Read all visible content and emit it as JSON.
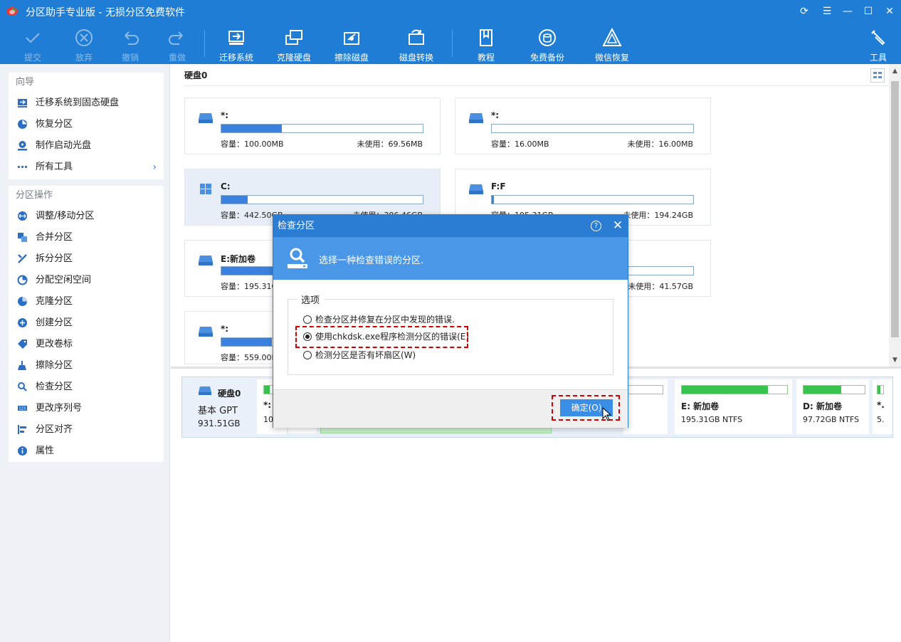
{
  "app": {
    "title": "分区助手专业版 - 无损分区免费软件"
  },
  "toolbar": {
    "items": [
      {
        "label": "提交",
        "icon": "check-icon",
        "disabled": true
      },
      {
        "label": "放弃",
        "icon": "discard-icon",
        "disabled": true
      },
      {
        "label": "撤销",
        "icon": "undo-icon",
        "disabled": true
      },
      {
        "label": "重做",
        "icon": "redo-icon",
        "disabled": true
      },
      {
        "label": "迁移系统",
        "icon": "migrate-os-icon"
      },
      {
        "label": "克隆硬盘",
        "icon": "clone-disk-icon"
      },
      {
        "label": "擦除磁盘",
        "icon": "wipe-disk-icon"
      },
      {
        "label": "磁盘转换",
        "icon": "convert-disk-icon"
      },
      {
        "label": "教程",
        "icon": "tutorial-icon"
      },
      {
        "label": "免费备份",
        "icon": "free-backup-icon"
      },
      {
        "label": "微信恢复",
        "icon": "wechat-recovery-icon"
      },
      {
        "label": "工具",
        "icon": "tools-icon"
      }
    ]
  },
  "sidebar": {
    "wizard": {
      "title": "向导",
      "items": [
        "迁移系统到固态硬盘",
        "恢复分区",
        "制作启动光盘",
        "所有工具"
      ]
    },
    "ops": {
      "title": "分区操作",
      "items": [
        "调整/移动分区",
        "合并分区",
        "拆分分区",
        "分配空闲空间",
        "克隆分区",
        "创建分区",
        "更改卷标",
        "擦除分区",
        "检查分区",
        "更改序列号",
        "分区对齐",
        "属性"
      ]
    }
  },
  "main": {
    "disk_label": "硬盘0",
    "partitions": [
      {
        "name": "*:",
        "cap": "容量：100.00MB",
        "unused": "未使用：69.56MB",
        "fill": 0.3
      },
      {
        "name": "*:",
        "cap": "容量：16.00MB",
        "unused": "未使用：16.00MB",
        "fill": 0.0
      },
      {
        "name": "C:",
        "cap": "容量：442.50GB",
        "unused": "未使用：386.46GB",
        "fill": 0.13
      },
      {
        "name": "F:F",
        "cap": "容量：195.31GB",
        "unused": "未使用：194.24GB",
        "fill": 0.01
      },
      {
        "name": "E:新加卷",
        "cap": "容量：195.31GB",
        "unused": "",
        "fill": 0.3
      },
      {
        "name": "",
        "cap": "",
        "unused": "未使用：41.57GB",
        "fill": 0.0
      },
      {
        "name": "*:",
        "cap": "容量：559.00MB",
        "unused": "",
        "fill": 0.25
      }
    ]
  },
  "diskmap": {
    "disk_name": "硬盘0",
    "type": "基本 GPT",
    "size": "931.51GB",
    "blocks": [
      {
        "name": "*:",
        "sub": "10",
        "fill": 0.3
      },
      {
        "name": "E: 新加卷",
        "sub": "195.31GB NTFS",
        "fill": 0.82
      },
      {
        "name": "D: 新加卷",
        "sub": "97.72GB NTFS",
        "fill": 0.62
      },
      {
        "name": "*.",
        "sub": "5.",
        "fill": 0.5
      }
    ]
  },
  "dialog": {
    "title": "检查分区",
    "help": "?",
    "banner": "选择一种检查错误的分区.",
    "group_label": "选项",
    "options": [
      {
        "label": "检查分区并修复在分区中发现的错误.",
        "selected": false
      },
      {
        "label": "使用chkdsk.exe程序检测分区的错误(E)",
        "selected": true
      },
      {
        "label": "检测分区是否有坏扇区(W)",
        "selected": false
      }
    ],
    "ok_label": "确定(O)"
  },
  "colors": {
    "accent": "#1f7dd6",
    "bar": "#3b82e0",
    "green": "#3ac24e",
    "highlight": "#d40000"
  }
}
